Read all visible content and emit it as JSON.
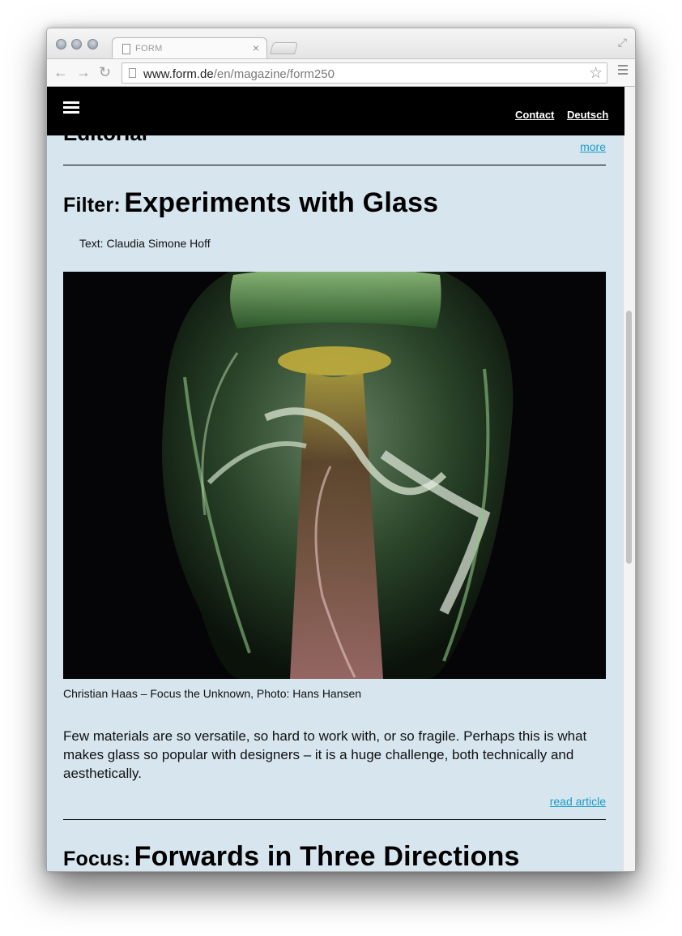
{
  "browser": {
    "tab_title": "FORM",
    "url_domain": "www.form.de",
    "url_path": "/en/magazine/form250"
  },
  "site_header": {
    "contact_label": "Contact",
    "language_label": "Deutsch"
  },
  "previous_section": {
    "heading": "Editorial",
    "more_label": "more"
  },
  "article": {
    "kicker": "Filter:",
    "title": "Experiments with Glass",
    "byline": "Text: Claudia Simone Hoff",
    "image_caption": "Christian Haas – Focus the Unknown, Photo: Hans Hansen",
    "teaser": "Few materials are so versatile, so hard to work with, or so fragile. Perhaps this is what makes glass so popular with designers – it is a huge challenge, both technically and aesthetically.",
    "read_label": "read article"
  },
  "next_article": {
    "kicker": "Focus:",
    "title": "Forwards in Three Directions"
  },
  "colors": {
    "page_background": "#d6e5ee",
    "link": "#1a9dc8",
    "header_background": "#000000"
  }
}
